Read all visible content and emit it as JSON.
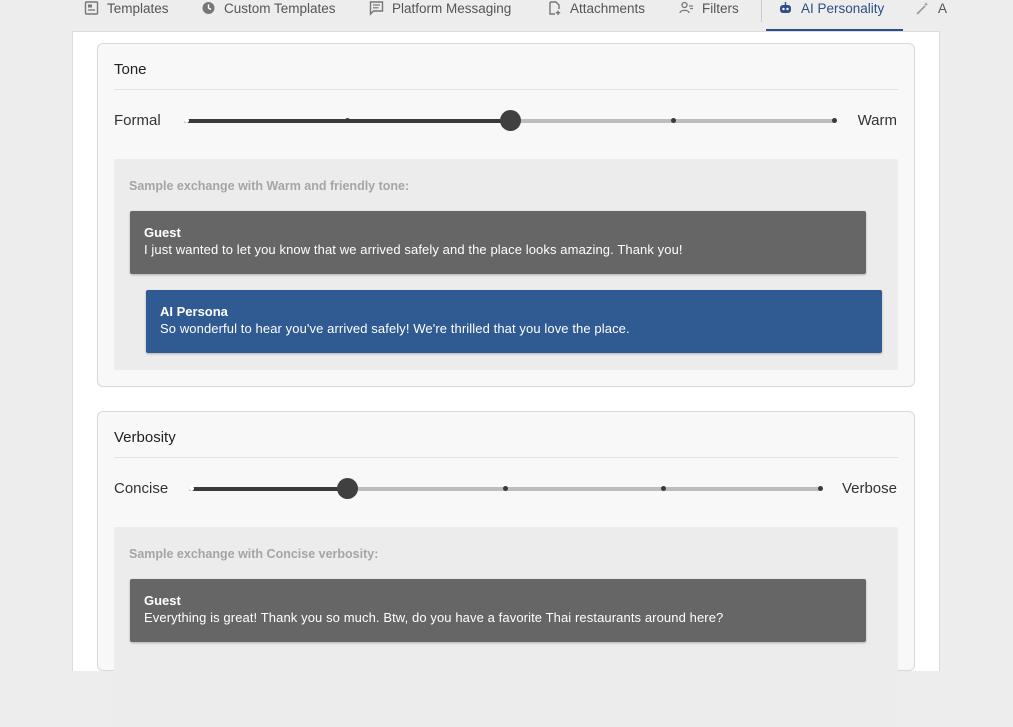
{
  "tabs": [
    {
      "label": "Templates",
      "icon": "templates-icon",
      "active": false
    },
    {
      "label": "Custom Templates",
      "icon": "clock-icon",
      "active": false
    },
    {
      "label": "Platform Messaging",
      "icon": "chat-bubble-icon",
      "active": false
    },
    {
      "label": "Attachments",
      "icon": "attachment-icon",
      "active": false
    },
    {
      "label": "Filters",
      "icon": "filter-icon",
      "active": false
    },
    {
      "label": "AI Personality",
      "icon": "robot-icon",
      "active": true
    },
    {
      "label": "A",
      "icon": "magic-wand-icon",
      "active": false
    }
  ],
  "colors": {
    "accent": "#2b4f86",
    "ai_bubble": "#2f5a92",
    "guest_bubble": "#666666"
  },
  "tone": {
    "title": "Tone",
    "min_label": "Formal",
    "max_label": "Warm",
    "steps": 5,
    "value_index": 2,
    "sample_caption": "Sample exchange with Warm and friendly tone:",
    "guest_name": "Guest",
    "guest_message": "I just wanted to let you know that we arrived safely and the place looks amazing. Thank you!",
    "ai_name": "AI Persona",
    "ai_message": "So wonderful to hear you've arrived safely! We're thrilled that you love the place."
  },
  "verbosity": {
    "title": "Verbosity",
    "min_label": "Concise",
    "max_label": "Verbose",
    "steps": 5,
    "value_index": 1,
    "sample_caption": "Sample exchange with Concise verbosity:",
    "guest_name": "Guest",
    "guest_message": "Everything is great! Thank you so much. Btw, do you have a favorite Thai restaurants around here?"
  }
}
